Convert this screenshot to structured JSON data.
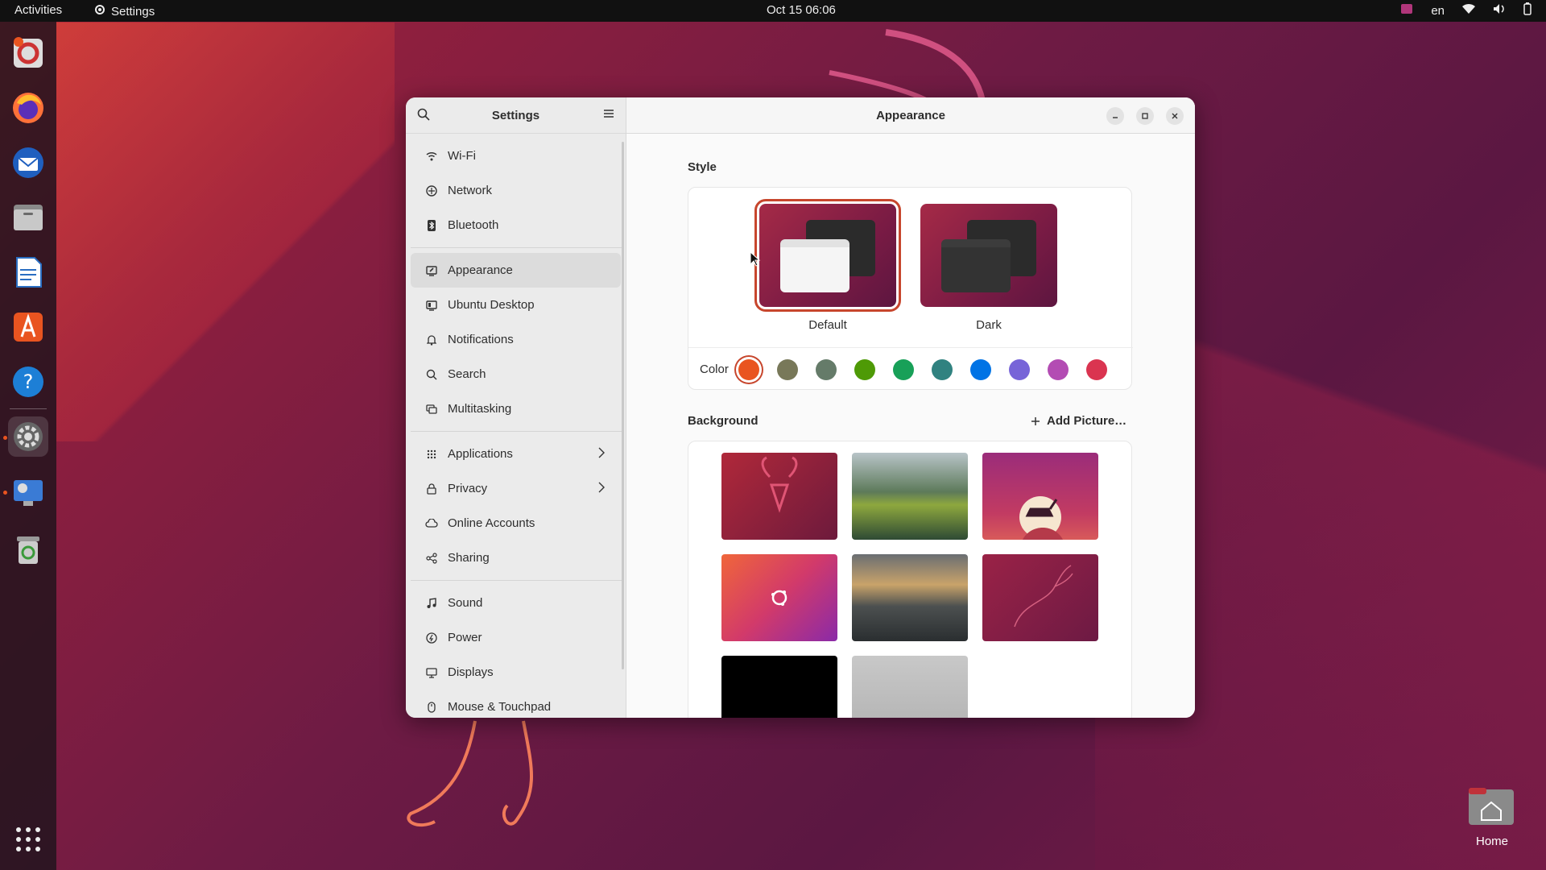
{
  "topbar": {
    "activities": "Activities",
    "app_name": "Settings",
    "clock": "Oct 15  06:06",
    "lang": "en"
  },
  "dock": {
    "items": [
      "help-icon-lifebuoy",
      "firefox-icon",
      "thunderbird-icon",
      "files-icon",
      "libreoffice-writer-icon",
      "app-center-icon",
      "help-icon",
      "settings-icon",
      "screenshot-icon",
      "trash-icon"
    ],
    "show_apps": "show-apps-icon"
  },
  "window": {
    "sidebar_title": "Settings",
    "main_title": "Appearance",
    "sidebar": {
      "groups": [
        [
          {
            "label": "Wi-Fi",
            "icon": "wifi-icon"
          },
          {
            "label": "Network",
            "icon": "network-icon"
          },
          {
            "label": "Bluetooth",
            "icon": "bluetooth-icon"
          }
        ],
        [
          {
            "label": "Appearance",
            "icon": "appearance-icon",
            "selected": true
          },
          {
            "label": "Ubuntu Desktop",
            "icon": "ubuntu-desktop-icon"
          },
          {
            "label": "Notifications",
            "icon": "bell-icon"
          },
          {
            "label": "Search",
            "icon": "search-icon"
          },
          {
            "label": "Multitasking",
            "icon": "multitasking-icon"
          }
        ],
        [
          {
            "label": "Applications",
            "icon": "applications-icon",
            "chevron": true
          },
          {
            "label": "Privacy",
            "icon": "lock-icon",
            "chevron": true
          },
          {
            "label": "Online Accounts",
            "icon": "cloud-icon"
          },
          {
            "label": "Sharing",
            "icon": "share-icon"
          }
        ],
        [
          {
            "label": "Sound",
            "icon": "music-note-icon"
          },
          {
            "label": "Power",
            "icon": "power-icon"
          },
          {
            "label": "Displays",
            "icon": "display-icon"
          },
          {
            "label": "Mouse & Touchpad",
            "icon": "mouse-icon"
          }
        ]
      ]
    },
    "appearance": {
      "style_title": "Style",
      "styles": [
        {
          "label": "Default",
          "selected": true
        },
        {
          "label": "Dark",
          "selected": false
        }
      ],
      "color_label": "Color",
      "colors": [
        "#e95420",
        "#787859",
        "#657b69",
        "#4e9a06",
        "#18a058",
        "#308280",
        "#0073e5",
        "#7764d8",
        "#b34cb3",
        "#da3450"
      ],
      "selected_color": "#e95420",
      "background_title": "Background",
      "add_picture": "Add Picture…"
    }
  },
  "desktop": {
    "home_label": "Home"
  }
}
